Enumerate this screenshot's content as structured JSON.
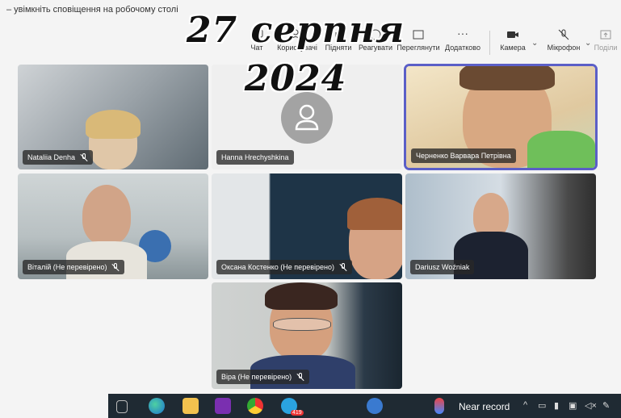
{
  "notification": {
    "text": "– увімкніть сповіщення на робочому столі"
  },
  "overlay": {
    "date": "27 серпня 2024"
  },
  "toolbar": {
    "items": [
      {
        "label": "Чат",
        "icon": "chat-icon"
      },
      {
        "label": "Користувачі",
        "icon": "people-icon"
      },
      {
        "label": "Підняти",
        "icon": "raise-hand-icon"
      },
      {
        "label": "Реагувати",
        "icon": "react-icon"
      },
      {
        "label": "Переглянути",
        "icon": "view-icon"
      },
      {
        "label": "Додатково",
        "icon": "more-icon",
        "glyph": "···"
      },
      {
        "label": "Камера",
        "icon": "camera-icon"
      },
      {
        "label": "Мікрофон",
        "icon": "mic-off-icon"
      },
      {
        "label": "Поділи",
        "icon": "share-icon"
      }
    ]
  },
  "participants": [
    {
      "name": "Nataliia Denha",
      "muted": true
    },
    {
      "name": "Hanna Hrechyshkina",
      "muted": false,
      "avatar": "person-placeholder-icon"
    },
    {
      "name": "Черненко Варвара Петрівна",
      "muted": false,
      "active": true
    },
    {
      "name": "Віталій (Не перевірено)",
      "muted": true
    },
    {
      "name": "Оксана Костенко (Не перевірено)",
      "muted": true
    },
    {
      "name": "Dariusz Woźniak",
      "muted": false
    },
    {
      "name": "Віра (Не перевірено)",
      "muted": true
    }
  ],
  "taskbar": {
    "apps": [
      "task-view-icon",
      "edge-icon",
      "file-explorer-icon",
      "onenote-icon",
      "chrome-icon",
      "telegram-icon",
      "help-icon"
    ],
    "telegram_badge": "419",
    "weather_text": "Near record",
    "tray_icons": [
      "chevron-up-icon",
      "battery-icon",
      "usb-icon",
      "meet-now-icon",
      "volume-muted-icon",
      "pen-icon"
    ]
  },
  "colors": {
    "accent": "#5b5fc7",
    "taskbar": "#1f2a33",
    "tag_bg": "#282828"
  }
}
